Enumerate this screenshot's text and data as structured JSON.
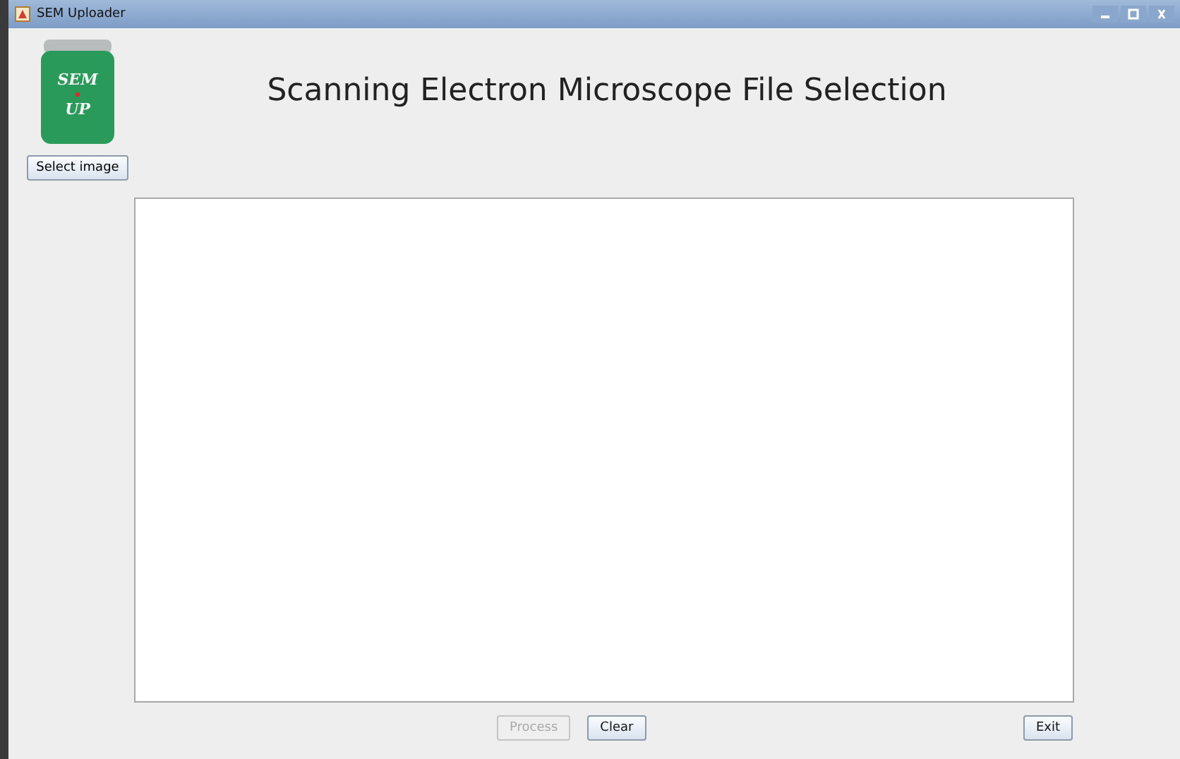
{
  "window": {
    "title": "SEM Uploader"
  },
  "logo": {
    "line_1": "SEM",
    "line_2": "UP"
  },
  "select_button": {
    "label": "Select image"
  },
  "heading": "Scanning Electron Microscope File Selection",
  "buttons": [
    {
      "label": "Process",
      "disabled": true
    },
    {
      "label": "Clear",
      "disabled": false
    }
  ],
  "exit_button": {
    "label": "Exit"
  }
}
